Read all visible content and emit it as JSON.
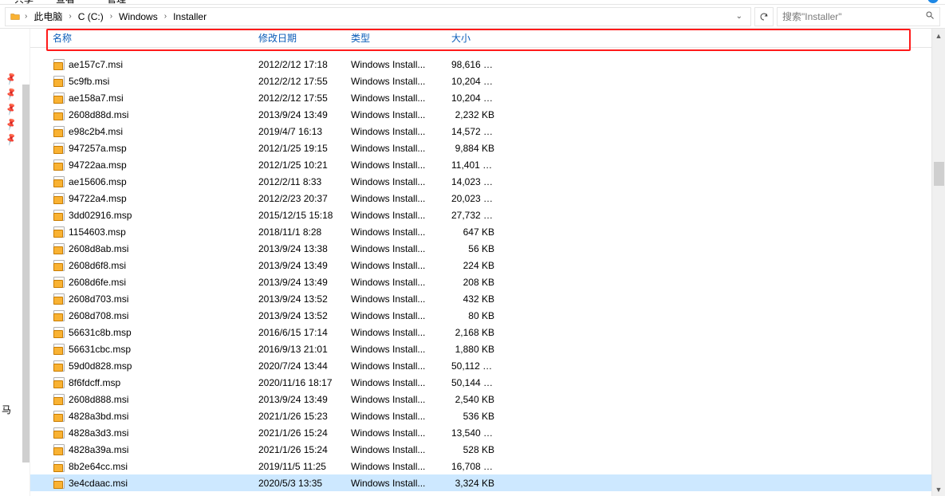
{
  "ribbon": {
    "tab1": "共享",
    "tab2": "查看",
    "tab3": "管理"
  },
  "breadcrumb": {
    "items": [
      "此电脑",
      "C (C:)",
      "Windows",
      "Installer"
    ]
  },
  "search": {
    "placeholder": "搜索\"Installer\""
  },
  "columns": {
    "name": "名称",
    "date": "修改日期",
    "type": "类型",
    "size": "大小"
  },
  "type_label": "Windows Install...",
  "size_unit": "KB",
  "sidebar_truncated": "马",
  "files": [
    {
      "name": "ae157c7.msi",
      "date": "2012/2/12 17:18",
      "size": "98,616"
    },
    {
      "name": "5c9fb.msi",
      "date": "2012/2/12 17:55",
      "size": "10,204"
    },
    {
      "name": "ae158a7.msi",
      "date": "2012/2/12 17:55",
      "size": "10,204"
    },
    {
      "name": "2608d88d.msi",
      "date": "2013/9/24 13:49",
      "size": "2,232"
    },
    {
      "name": "e98c2b4.msi",
      "date": "2019/4/7 16:13",
      "size": "14,572"
    },
    {
      "name": "947257a.msp",
      "date": "2012/1/25 19:15",
      "size": "9,884"
    },
    {
      "name": "94722aa.msp",
      "date": "2012/1/25 10:21",
      "size": "11,401"
    },
    {
      "name": "ae15606.msp",
      "date": "2012/2/11 8:33",
      "size": "14,023"
    },
    {
      "name": "94722a4.msp",
      "date": "2012/2/23 20:37",
      "size": "20,023"
    },
    {
      "name": "3dd02916.msp",
      "date": "2015/12/15 15:18",
      "size": "27,732"
    },
    {
      "name": "1154603.msp",
      "date": "2018/11/1 8:28",
      "size": "647"
    },
    {
      "name": "2608d8ab.msi",
      "date": "2013/9/24 13:38",
      "size": "56"
    },
    {
      "name": "2608d6f8.msi",
      "date": "2013/9/24 13:49",
      "size": "224"
    },
    {
      "name": "2608d6fe.msi",
      "date": "2013/9/24 13:49",
      "size": "208"
    },
    {
      "name": "2608d703.msi",
      "date": "2013/9/24 13:52",
      "size": "432"
    },
    {
      "name": "2608d708.msi",
      "date": "2013/9/24 13:52",
      "size": "80"
    },
    {
      "name": "56631c8b.msp",
      "date": "2016/6/15 17:14",
      "size": "2,168"
    },
    {
      "name": "56631cbc.msp",
      "date": "2016/9/13 21:01",
      "size": "1,880"
    },
    {
      "name": "59d0d828.msp",
      "date": "2020/7/24 13:44",
      "size": "50,112"
    },
    {
      "name": "8f6fdcff.msp",
      "date": "2020/11/16 18:17",
      "size": "50,144"
    },
    {
      "name": "2608d888.msi",
      "date": "2013/9/24 13:49",
      "size": "2,540"
    },
    {
      "name": "4828a3bd.msi",
      "date": "2021/1/26 15:23",
      "size": "536"
    },
    {
      "name": "4828a3d3.msi",
      "date": "2021/1/26 15:24",
      "size": "13,540"
    },
    {
      "name": "4828a39a.msi",
      "date": "2021/1/26 15:24",
      "size": "528"
    },
    {
      "name": "8b2e64cc.msi",
      "date": "2019/11/5 11:25",
      "size": "16,708"
    },
    {
      "name": "3e4cdaac.msi",
      "date": "2020/5/3 13:35",
      "size": "3,324",
      "selected": true
    }
  ]
}
